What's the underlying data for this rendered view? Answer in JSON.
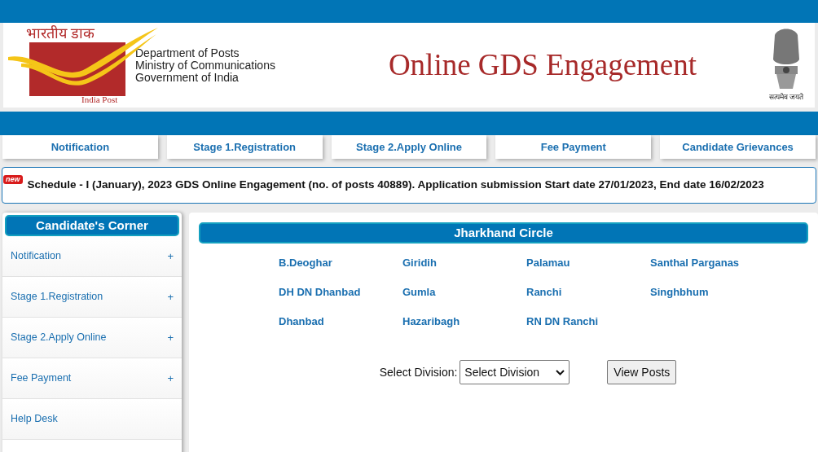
{
  "header": {
    "logo_hindi": "भारतीय डाक",
    "logo_caption": "India Post",
    "department_lines": [
      "Department of Posts",
      "Ministry of Communications",
      "Government of India"
    ],
    "title": "Online GDS Engagement",
    "emblem_motto": "सत्यमेव जयते"
  },
  "nav": [
    "Notification",
    "Stage 1.Registration",
    "Stage 2.Apply Online",
    "Fee Payment",
    "Candidate Grievances"
  ],
  "announcement": {
    "badge": "new",
    "text": "Schedule - I (January), 2023 GDS Online Engagement (no. of posts 40889). Application submission Start date 27/01/2023, End date 16/02/2023"
  },
  "sidebar": {
    "title": "Candidate's Corner",
    "items": [
      {
        "label": "Notification",
        "expandable": true
      },
      {
        "label": "Stage 1.Registration",
        "expandable": true
      },
      {
        "label": "Stage 2.Apply Online",
        "expandable": true
      },
      {
        "label": "Fee Payment",
        "expandable": true
      },
      {
        "label": "Help Desk",
        "expandable": false
      }
    ],
    "expand_symbol": "+"
  },
  "circle": {
    "title": "Jharkhand Circle",
    "divisions": [
      "B.Deoghar",
      "Giridih",
      "Palamau",
      "Santhal Parganas",
      "DH DN Dhanbad",
      "Gumla",
      "Ranchi",
      "Singhbhum",
      "Dhanbad",
      "Hazaribagh",
      "RN DN Ranchi"
    ],
    "select_label": "Select Division:",
    "select_value": "Select Division",
    "button": "View Posts"
  }
}
